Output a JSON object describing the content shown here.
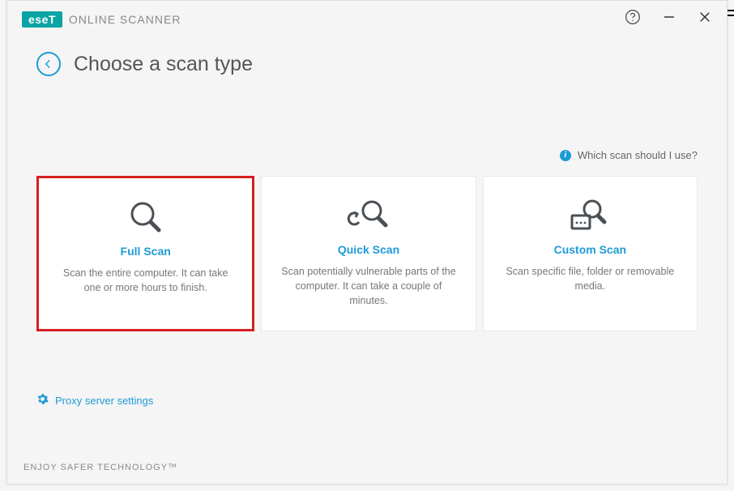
{
  "brand": {
    "logo": "eseT",
    "product": "ONLINE SCANNER"
  },
  "header": {
    "title": "Choose a scan type"
  },
  "help": {
    "which_scan": "Which scan should I use?"
  },
  "cards": [
    {
      "title": "Full Scan",
      "desc": "Scan the entire computer. It can take one or more hours to finish."
    },
    {
      "title": "Quick Scan",
      "desc": "Scan potentially vulnerable parts of the computer. It can take a couple of minutes."
    },
    {
      "title": "Custom Scan",
      "desc": "Scan specific file, folder or removable media."
    }
  ],
  "links": {
    "proxy": "Proxy server settings"
  },
  "footer": {
    "tagline": "ENJOY SAFER TECHNOLOGY™"
  }
}
